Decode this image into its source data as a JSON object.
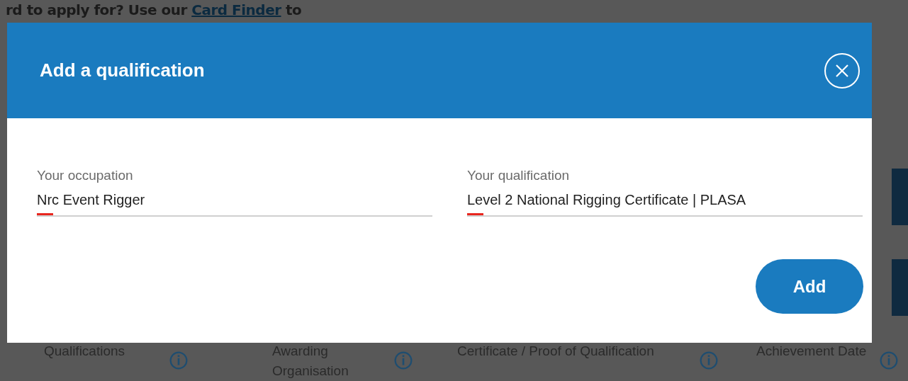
{
  "page": {
    "intro": {
      "before": "rd to apply for? Use our",
      "link": "Card Finder",
      "after": "to"
    },
    "table_header": [
      {
        "label": "Qualifications"
      },
      {
        "label": "Awarding Organisation"
      },
      {
        "label": "Certificate / Proof of Qualification"
      },
      {
        "label": "Achievement Date"
      }
    ]
  },
  "dialog": {
    "title": "Add a qualification",
    "fields": [
      {
        "label": "Your occupation",
        "value": "Nrc Event Rigger"
      },
      {
        "label": "Your qualification",
        "value": "Level 2 National Rigging Certificate | PLASA"
      }
    ],
    "button": "Add"
  }
}
